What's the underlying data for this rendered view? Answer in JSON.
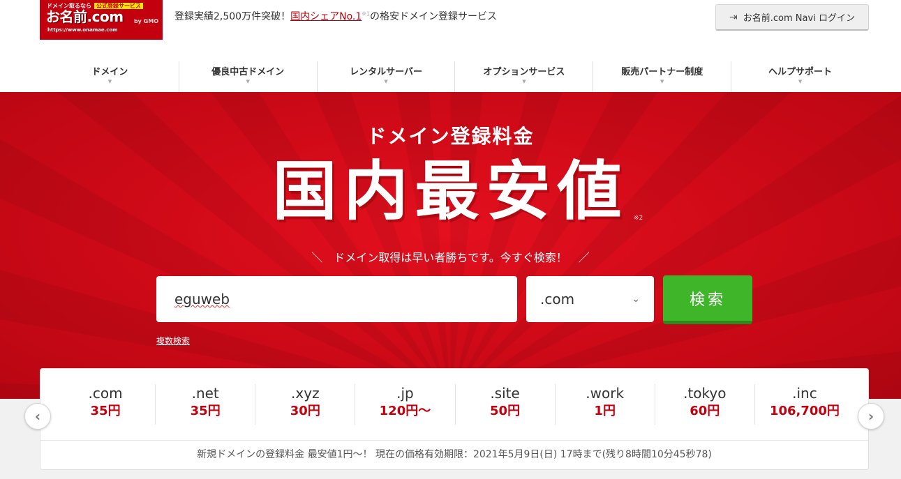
{
  "header": {
    "logo": {
      "line1": "ドメイン取るなら",
      "badge": "公式登録サービス",
      "brand": "お名前.com",
      "url": "https://www.onamae.com",
      "maker": "by GMO"
    },
    "tagline_pre": "登録実績2,500万件突破！",
    "tagline_link": "国内シェアNo.1",
    "tagline_note": "※1",
    "tagline_post": "の格安ドメイン登録サービス",
    "login_label": "お名前.com Navi ログイン"
  },
  "nav": {
    "items": [
      {
        "label": "ドメイン"
      },
      {
        "label": "優良中古ドメイン"
      },
      {
        "label": "レンタルサーバー"
      },
      {
        "label": "オプションサービス"
      },
      {
        "label": "販売パートナー制度"
      },
      {
        "label": "ヘルプサポート"
      }
    ]
  },
  "hero": {
    "subtitle": "ドメイン登録料金",
    "title": "国内最安値",
    "note": "※2",
    "cta": "＼　ドメイン取得は早い者勝ちです。今すぐ検索！　／"
  },
  "search": {
    "value": "eguweb",
    "tld": ".com",
    "button_label": "検索",
    "multi_label": "複数検索"
  },
  "prices": [
    {
      "tld": ".com",
      "price": "35円"
    },
    {
      "tld": ".net",
      "price": "35円"
    },
    {
      "tld": ".xyz",
      "price": "30円"
    },
    {
      "tld": ".jp",
      "price": "120円〜"
    },
    {
      "tld": ".site",
      "price": "50円"
    },
    {
      "tld": ".work",
      "price": "1円"
    },
    {
      "tld": ".tokyo",
      "price": "60円"
    },
    {
      "tld": ".inc",
      "price": "106,700円"
    }
  ],
  "notice": "新規ドメインの登録料金 最安値1円〜！ 現在の価格有効期限：2021年5月9日(日) 17時まで(残り8時間10分45秒78)",
  "colors": {
    "brand_red": "#c3000d",
    "search_green": "#3fb62a"
  }
}
